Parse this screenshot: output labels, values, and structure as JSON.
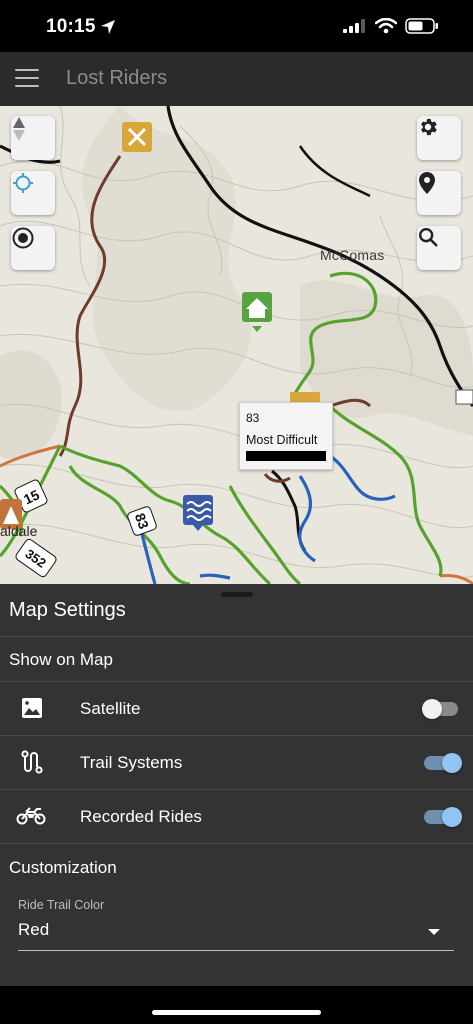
{
  "status_bar": {
    "time": "10:15"
  },
  "app_bar": {
    "title": "Lost Riders"
  },
  "map": {
    "town_label": "McComas",
    "place_label": "aldale",
    "route_labels": [
      "15",
      "83",
      "352"
    ],
    "popup": {
      "trail_id": "83",
      "difficulty": "Most Difficult"
    },
    "colors": {
      "trail_green": "#55a32c",
      "trail_blue": "#2763b8",
      "trail_brown": "#6e3c2c",
      "road_black": "#111111",
      "road_orange": "#d2753f"
    }
  },
  "settings": {
    "title": "Map Settings",
    "show_on_map_label": "Show on Map",
    "rows": [
      {
        "label": "Satellite",
        "icon": "image-icon",
        "enabled": false
      },
      {
        "label": "Trail Systems",
        "icon": "route-icon",
        "enabled": true
      },
      {
        "label": "Recorded Rides",
        "icon": "motorcycle-icon",
        "enabled": true
      }
    ],
    "customization_label": "Customization",
    "ride_trail_color": {
      "label": "Ride Trail Color",
      "value": "Red"
    }
  },
  "colors": {
    "sheet_bg": "#333333",
    "app_bar_bg": "#2b2b2b",
    "toggle_on": "#90c4f4"
  }
}
